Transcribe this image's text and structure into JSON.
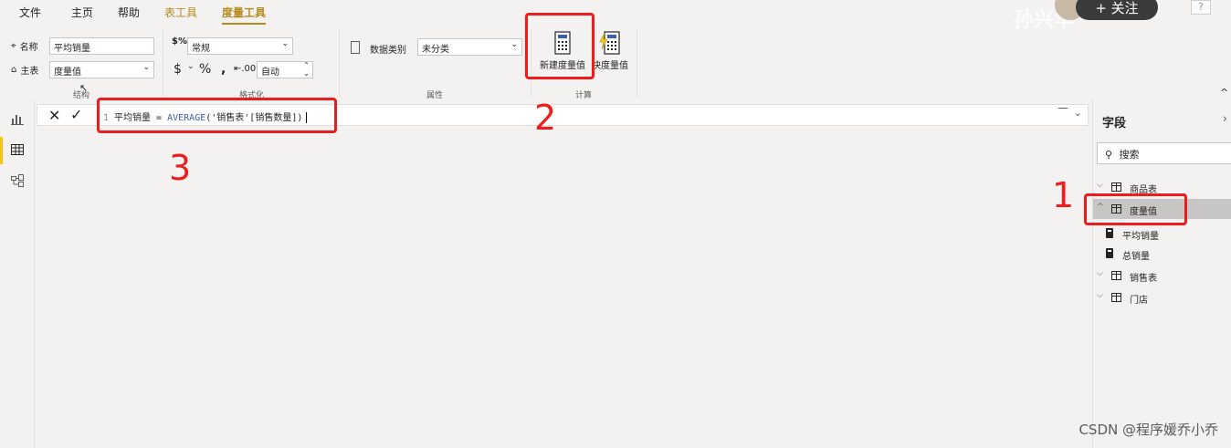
{
  "menu": {
    "items": [
      {
        "label": "文件"
      },
      {
        "label": "主页"
      },
      {
        "label": "帮助"
      },
      {
        "label": "表工具"
      },
      {
        "label": "度量工具"
      }
    ]
  },
  "ribbon": {
    "structure": {
      "name_label": "名称",
      "name_value": "平均销量",
      "home_table_label": "主表",
      "home_table_value": "度量值",
      "group_label": "结构"
    },
    "formatting": {
      "format_value": "常规",
      "auto_value": "自动",
      "group_label": "格式化"
    },
    "properties": {
      "data_category_label": "数据类别",
      "data_category_value": "未分类",
      "group_label": "属性"
    },
    "calculations": {
      "new_measure_label": "新建度量值",
      "quick_measure_label": "快度量值",
      "group_label": "计算"
    }
  },
  "formula_bar": {
    "line_number": "1",
    "formula_name": "平均销量",
    "formula_eq": " = ",
    "formula_fn": "AVERAGE",
    "formula_args": "('销售表'[销售数量])"
  },
  "fields": {
    "title": "字段",
    "search_placeholder": "搜索",
    "tables": [
      {
        "label": "商品表",
        "expanded": false
      },
      {
        "label": "度量值",
        "expanded": true,
        "selected": true
      },
      {
        "label": "销售表",
        "expanded": false
      },
      {
        "label": "门店",
        "expanded": false
      }
    ],
    "measures": [
      {
        "label": "平均销量"
      },
      {
        "label": "总销量"
      }
    ]
  },
  "annotations": {
    "num1": "1",
    "num2": "2",
    "num3": "3",
    "color": "#ee1c1c"
  },
  "overlay": {
    "follow_label": "+ 关注",
    "watermark_top": "孙兴华",
    "help": "?",
    "watermark": "CSDN @程序媛乔小乔"
  }
}
